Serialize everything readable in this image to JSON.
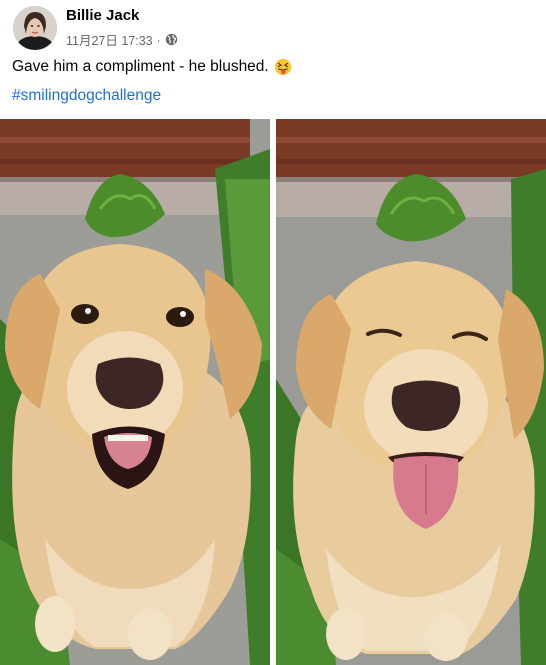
{
  "post": {
    "author": "Billie Jack",
    "timestamp": "11月27日 17:33",
    "separator": "·",
    "audience_icon": "globe-icon",
    "text": "Gave him a compliment - he blushed.",
    "emoji": "squinting-face-with-tongue",
    "hashtag": "#smilingdogchallenge"
  },
  "photos": [
    {
      "name": "photo-dog-eyes-open",
      "description_icon": "dog-smiling-mouth-open"
    },
    {
      "name": "photo-dog-eyes-closed",
      "description_icon": "dog-blushing-tongue-out"
    }
  ],
  "colors": {
    "text": "#050505",
    "secondary_text": "#65676b",
    "hashtag": "#216fdb",
    "fur": "#e7c38e",
    "pavement": "#9a9a96",
    "grass": "#3f7d2a",
    "fence": "#7a3a26"
  }
}
